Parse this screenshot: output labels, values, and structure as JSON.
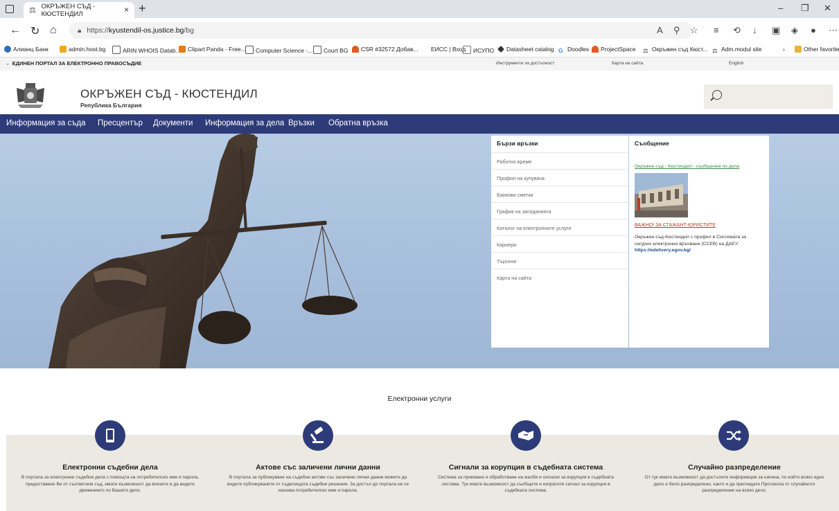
{
  "browser": {
    "tab_title": "ОКРЪЖЕН СЪД - КЮСТЕНДИЛ",
    "url_prefix": "https://",
    "url_host": "kyustendil-os.justice.bg",
    "url_path": "/bg",
    "bookmarks": [
      {
        "label": "Алианц Банк",
        "color": "#2e6fb7"
      },
      {
        "label": "admin.host.bg",
        "color": "#f0a81c"
      },
      {
        "label": "ARIN WHOIS Datab...",
        "color": "#ffffff"
      },
      {
        "label": "Clipart Panda - Free...",
        "color": "#e07a1c"
      },
      {
        "label": "Computer Science -...",
        "color": "#ffffff"
      },
      {
        "label": "Court BG",
        "color": "#ffffff"
      },
      {
        "label": "CSR #32572 Добав...",
        "color": "#e55a1c"
      },
      {
        "label": "ЕИСС | Вход",
        "color": "#ffffff"
      },
      {
        "label": "ИСУПО",
        "color": "#888888"
      },
      {
        "label": "Datasheet catalog",
        "color": "#333333"
      },
      {
        "label": "Doodles",
        "color": "#4285f4"
      },
      {
        "label": "ProjectSpace",
        "color": "#e55a1c"
      },
      {
        "label": "Окръжен съд Кюст...",
        "color": "#333333"
      },
      {
        "label": "Adm.modul site",
        "color": "#333333"
      }
    ],
    "other_favorites": "Other favorites"
  },
  "portal": {
    "back_label": "ЕДИНЕН ПОРТАЛ ЗА ЕЛЕКТРОННО ПРАВОСЪДИЕ",
    "links": [
      "Инструменти за достъпност",
      "Карта на сайта",
      "English"
    ]
  },
  "header": {
    "court_name": "ОКРЪЖЕН СЪД - КЮСТЕНДИЛ",
    "subtitle": "Република България"
  },
  "nav": [
    "Информация за съда",
    "Пресцентър",
    "Документи",
    "Информация за дела",
    "Връзки",
    "Обратна връзка"
  ],
  "quick_links": {
    "title": "Бързи връзки",
    "items": [
      "Работно време",
      "Профил на купувача",
      "Банкови сметки",
      "График на заседанията",
      "Каталог на електронните услуги",
      "Кариери",
      "Търсене",
      "Карта на сайта"
    ]
  },
  "message": {
    "title": "Съобщение",
    "link1": "Окръжен съд - Кюстендил - съобщения по дела",
    "link2": "ВАЖНО! ЗА СТАЖАНТ-ЮРИСТИТЕ",
    "text": "Окръжен съд-Кюстендил с профил в Системата за сигурно електронно връчване (ССЕВ) на ДАЕУ:",
    "url": "https://edelivery.egov.bg/"
  },
  "eservices": {
    "title": "Електронни услуги",
    "items": [
      {
        "title": "Електронни съдебни дела",
        "icon": "phone-icon",
        "text": "В портала за електронни съдебни дела с помощта на потребителско име и парола, предоставени Ви от съответния съд, имате възможност да влезете и да видите движението по Вашето дело."
      },
      {
        "title": "Актове със заличени лични данни",
        "icon": "gavel-icon",
        "text": "В портала за публикуване на съдебни актове със заличени лични данни можете да видите публикуваните от съдилищата съдебни решения. За достъп до портала не се изисква потребителско име и парола."
      },
      {
        "title": "Сигнали за корупция в съдебната система",
        "icon": "handshake-icon",
        "text": "Система за приемане и обработване на жалби и сигнали за корупция в съдебната система. Тук имате възможност да съобщите и изпратите сигнал за корупция в съдебната система."
      },
      {
        "title": "Случайно разпределение",
        "icon": "shuffle-icon",
        "text": "От тук имате възможност да достъпите информация за начина, по който всяко едно дело е било разпределено, както и да прегледате Протокола от случайното разпределение на всяко дело."
      }
    ]
  },
  "colors": {
    "nav_bg": "#2d3b78",
    "accent": "#2d3b78",
    "service_bg": "#ece9e2"
  }
}
